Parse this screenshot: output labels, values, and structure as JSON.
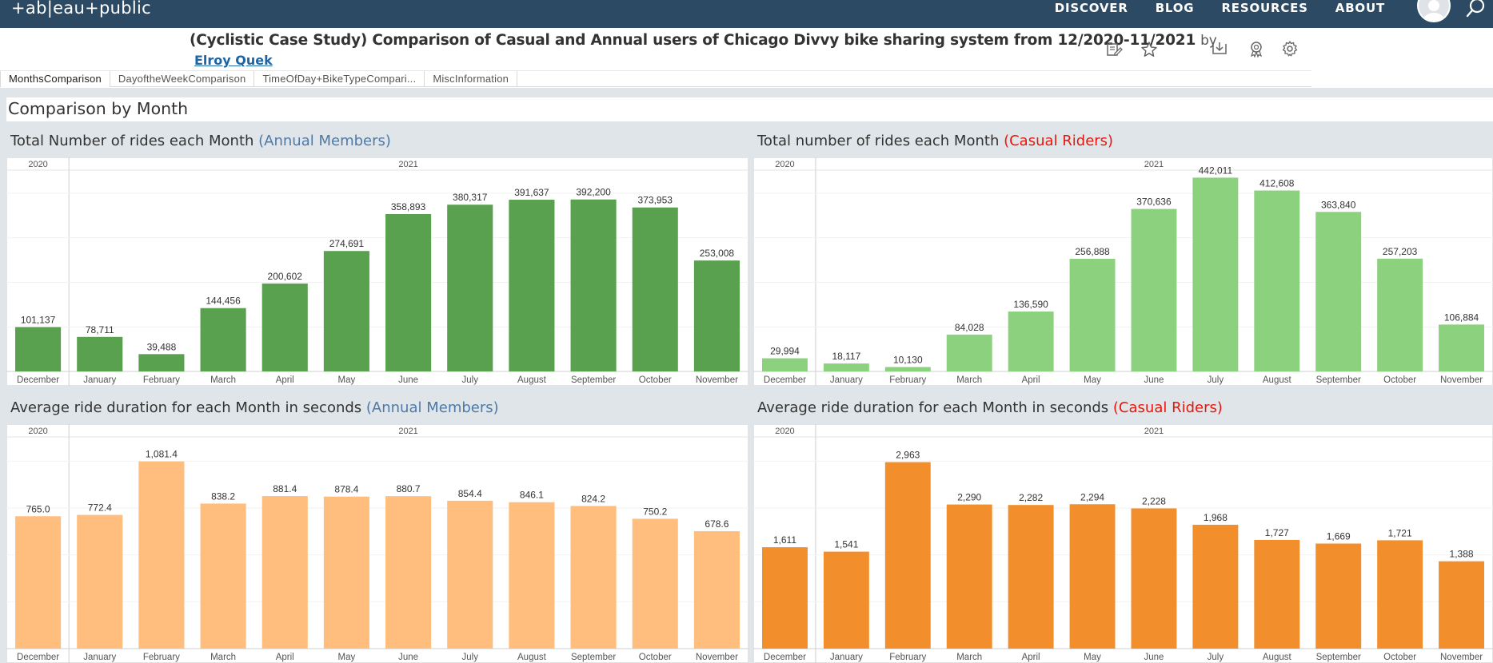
{
  "nav": {
    "logo": "+ab|eau+public",
    "links": [
      "DISCOVER",
      "BLOG",
      "RESOURCES",
      "ABOUT"
    ]
  },
  "header": {
    "title": "(Cyclistic Case Study) Comparison of Casual and Annual users of Chicago Divvy bike sharing system from 12/2020-11/2021",
    "by": "by",
    "author": "Elroy Quek"
  },
  "tabs": [
    "MonthsComparison",
    "DayoftheWeekComparison",
    "TimeOfDay+BikeTypeCompari...",
    "MiscInformation"
  ],
  "dashboard": {
    "title": "Comparison by Month"
  },
  "panels": [
    {
      "title_main": "Total Number of rides each Month",
      "title_tag": "(Annual Members)"
    },
    {
      "title_main": "Total number of rides each Month",
      "title_tag": "(Casual Riders)"
    },
    {
      "title_main": "Average ride duration for each Month in seconds",
      "title_tag": "(Annual Members)"
    },
    {
      "title_main": "Average ride duration for each Month in seconds",
      "title_tag": "(Casual Riders)"
    }
  ],
  "colors": {
    "nav_bg": "#2c4a63",
    "annual_rides": "#59a14f",
    "casual_rides": "#8cd17d",
    "annual_duration": "#ffbe7d",
    "casual_duration": "#f28e2b",
    "annual_tag": "#4e79a7",
    "casual_tag": "#e8160c"
  },
  "chart_data": [
    {
      "type": "bar",
      "year_headers": [
        "2020",
        "2021"
      ],
      "categories": [
        "December",
        "January",
        "February",
        "March",
        "April",
        "May",
        "June",
        "July",
        "August",
        "September",
        "October",
        "November"
      ],
      "values": [
        101137,
        78711,
        39488,
        144456,
        200602,
        274691,
        358893,
        380317,
        391637,
        392200,
        373953,
        253008
      ],
      "labels": [
        "101,137",
        "78,711",
        "39,488",
        "144,456",
        "200,602",
        "274,691",
        "358,893",
        "380,317",
        "391,637",
        "392,200",
        "373,953",
        "253,008"
      ],
      "ylim": [
        0,
        450000
      ]
    },
    {
      "type": "bar",
      "year_headers": [
        "2020",
        "2021"
      ],
      "categories": [
        "December",
        "January",
        "February",
        "March",
        "April",
        "May",
        "June",
        "July",
        "August",
        "September",
        "October",
        "November"
      ],
      "values": [
        29994,
        18117,
        10130,
        84028,
        136590,
        256888,
        370636,
        442011,
        412608,
        363840,
        257203,
        106884
      ],
      "labels": [
        "29,994",
        "18,117",
        "10,130",
        "84,028",
        "136,590",
        "256,888",
        "370,636",
        "442,011",
        "412,608",
        "363,840",
        "257,203",
        "106,884"
      ],
      "ylim": [
        0,
        450000
      ]
    },
    {
      "type": "bar",
      "year_headers": [
        "2020",
        "2021"
      ],
      "categories": [
        "December",
        "January",
        "February",
        "March",
        "April",
        "May",
        "June",
        "July",
        "August",
        "September",
        "October",
        "November"
      ],
      "values": [
        765.0,
        772.4,
        1081.4,
        838.2,
        881.4,
        878.4,
        880.7,
        854.4,
        846.1,
        824.2,
        750.2,
        678.6
      ],
      "labels": [
        "765.0",
        "772.4",
        "1,081.4",
        "838.2",
        "881.4",
        "878.4",
        "880.7",
        "854.4",
        "846.1",
        "824.2",
        "750.2",
        "678.6"
      ],
      "ylim": [
        0,
        1200
      ]
    },
    {
      "type": "bar",
      "year_headers": [
        "2020",
        "2021"
      ],
      "categories": [
        "December",
        "January",
        "February",
        "March",
        "April",
        "May",
        "June",
        "July",
        "August",
        "September",
        "October",
        "November"
      ],
      "values": [
        1611,
        1541,
        2963,
        2290,
        2282,
        2294,
        2228,
        1968,
        1727,
        1669,
        1721,
        1388
      ],
      "labels": [
        "1,611",
        "1,541",
        "2,963",
        "2,290",
        "2,282",
        "2,294",
        "2,228",
        "1,968",
        "1,727",
        "1,669",
        "1,721",
        "1,388"
      ],
      "ylim": [
        0,
        3300
      ]
    }
  ]
}
